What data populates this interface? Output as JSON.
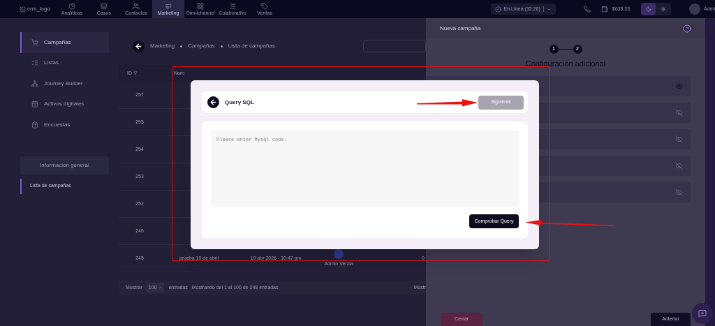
{
  "nav": {
    "logo_alt": "crm_logo",
    "tabs": [
      {
        "label": "Analíticas",
        "selected": false
      },
      {
        "label": "Casos",
        "selected": false
      },
      {
        "label": "Contactos",
        "selected": false
      },
      {
        "label": "Marketing",
        "selected": true
      },
      {
        "label": "Omnichannel",
        "selected": false
      },
      {
        "label": "Colaborativo",
        "selected": false
      },
      {
        "label": "Ventas",
        "selected": false
      }
    ],
    "status": "En Línea (32:26)",
    "balance": "$635.33",
    "dark_mode": true,
    "user": "Admi"
  },
  "sidebar": {
    "items": [
      {
        "label": "Campañas",
        "selected": true
      },
      {
        "label": "Listas",
        "selected": false
      },
      {
        "label": "Journey Builder",
        "selected": false
      },
      {
        "label": "Activos digitales",
        "selected": false
      },
      {
        "label": "Encuestas",
        "selected": false
      }
    ],
    "section": "Informacion general",
    "sub_items": [
      {
        "label": "Lista de campañas",
        "selected": true
      }
    ]
  },
  "breadcrumb": [
    "Marketing",
    "Campañas",
    "Lista de campañas"
  ],
  "table": {
    "columns": [
      "ID",
      "Nom"
    ],
    "rows": [
      {
        "id": "257"
      },
      {
        "id": "255"
      },
      {
        "id": "254"
      },
      {
        "id": "253"
      },
      {
        "id": "252"
      },
      {
        "id": "246"
      },
      {
        "id": "245",
        "name": "prueba 10 de abril",
        "date": "10 abr 2026 - 10:47 am",
        "owner": "Admin Verzia",
        "count": "0"
      }
    ]
  },
  "footer": {
    "show": "Mostrar",
    "page_size": "100",
    "entries": "entradas",
    "info": "Mostrando del 1 al 100 de 248 entradas",
    "right": "Mostr"
  },
  "panel": {
    "title": "Nueva campaña",
    "steps": [
      "1",
      "2"
    ],
    "subtitle": "Configuración adicional",
    "rows": [
      {
        "visible": true
      },
      {
        "visible": false
      },
      {
        "visible": false
      },
      {
        "visible": false
      },
      {
        "visible": false
      }
    ],
    "close": "Cerrar",
    "previous": "Anterior"
  },
  "modal": {
    "title": "Query SQL",
    "next": {
      "label": "Siguiente",
      "disabled": true
    },
    "placeholder": "Please enter Mysql code.",
    "check": "Comprobar Query"
  }
}
